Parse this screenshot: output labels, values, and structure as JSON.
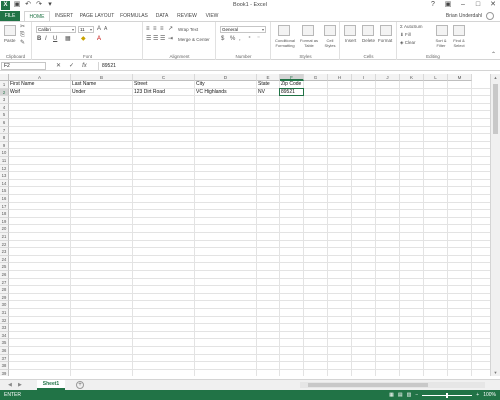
{
  "title": "Book1 - Excel",
  "user": "Brian Underdahl",
  "tabs": [
    "FILE",
    "HOME",
    "INSERT",
    "PAGE LAYOUT",
    "FORMULAS",
    "DATA",
    "REVIEW",
    "VIEW"
  ],
  "ribbon": {
    "paste": "Paste",
    "clipboard": "Clipboard",
    "font_name": "Calibri",
    "font_size": "11",
    "font": "Font",
    "wrap_text": "Wrap Text",
    "merge_center": "Merge & Center",
    "alignment": "Alignment",
    "number_format": "General",
    "number": "Number",
    "conditional_formatting": "Conditional Formatting",
    "format_as_table": "Format as Table",
    "cell_styles": "Cell Styles",
    "styles": "Styles",
    "insert": "Insert",
    "delete": "Delete",
    "format": "Format",
    "cells": "Cells",
    "autosum": "AutoSum",
    "fill": "Fill",
    "clear": "Clear",
    "sort_filter": "Sort & Filter",
    "find_select": "Find & Select",
    "editing": "Editing"
  },
  "formula_bar": {
    "name_box": "F2",
    "fx": "fx",
    "value": "89521"
  },
  "columns": [
    "A",
    "B",
    "C",
    "D",
    "E",
    "F",
    "G",
    "H",
    "I",
    "J",
    "K",
    "L",
    "M"
  ],
  "rows": [
    "1",
    "2",
    "3",
    "4",
    "5",
    "6",
    "7",
    "8",
    "9",
    "10",
    "11",
    "12",
    "13",
    "14",
    "15",
    "16",
    "17",
    "18",
    "19",
    "20",
    "21",
    "22",
    "23",
    "24",
    "25",
    "26",
    "27",
    "28",
    "29",
    "30",
    "31",
    "32",
    "33",
    "34",
    "35",
    "36",
    "37",
    "38",
    "39"
  ],
  "cells": {
    "A1": "First Name",
    "B1": "Last Name",
    "C1": "Street",
    "D1": "City",
    "E1": "State",
    "F1": "Zip Code",
    "A2": "Woif",
    "B2": "Under",
    "C2": "123 Dirt Road",
    "D2": "VC Highlands",
    "E2": "NV",
    "F2": "89521"
  },
  "active_cell": "F2",
  "sheet_tab": "Sheet1",
  "status": "ENTER",
  "zoom": "100%"
}
